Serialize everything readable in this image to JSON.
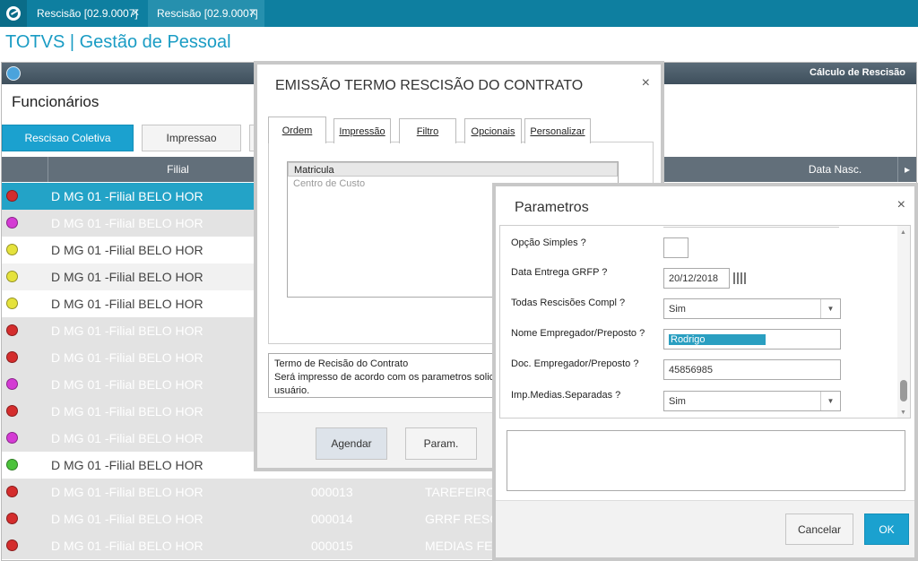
{
  "tabs": [
    {
      "label": "Rescisão [02.9.0007]"
    },
    {
      "label": "Rescisão [02.9.0007]"
    }
  ],
  "app_title": "TOTVS | Gestão de Pessoal",
  "main": {
    "bar_title": "Cálculo de Rescisão",
    "section_title": "Funcionários",
    "buttons": {
      "rescisao": "Rescisao Coletiva",
      "impressao": "Impressao"
    },
    "columns": {
      "filial": "Filial",
      "data_nasc": "Data Nasc."
    },
    "rows": [
      {
        "filial": "D MG 01 -Filial BELO HOR",
        "mat": "",
        "func": ""
      },
      {
        "filial": "D MG 01 -Filial BELO HOR",
        "mat": "",
        "func": ""
      },
      {
        "filial": "D MG 01 -Filial BELO HOR",
        "mat": "",
        "func": ""
      },
      {
        "filial": "D MG 01 -Filial BELO HOR",
        "mat": "",
        "func": ""
      },
      {
        "filial": "D MG 01 -Filial BELO HOR",
        "mat": "",
        "func": ""
      },
      {
        "filial": "D MG 01 -Filial BELO HOR",
        "mat": "",
        "func": ""
      },
      {
        "filial": "D MG 01 -Filial BELO HOR",
        "mat": "",
        "func": ""
      },
      {
        "filial": "D MG 01 -Filial BELO HOR",
        "mat": "",
        "func": ""
      },
      {
        "filial": "D MG 01 -Filial BELO HOR",
        "mat": "",
        "func": ""
      },
      {
        "filial": "D MG 01 -Filial BELO HOR",
        "mat": "",
        "func": ""
      },
      {
        "filial": "D MG 01 -Filial BELO HOR",
        "mat": "",
        "func": ""
      },
      {
        "filial": "D MG 01 -Filial BELO HOR",
        "mat": "000013",
        "func": "TAREFEIRO"
      },
      {
        "filial": "D MG 01 -Filial BELO HOR",
        "mat": "000014",
        "func": "GRRF RESC"
      },
      {
        "filial": "D MG 01 -Filial BELO HOR",
        "mat": "000015",
        "func": "MEDIAS FE"
      }
    ],
    "status_colors": [
      "#d42d2d",
      "#d43bd4",
      "#e5e23c",
      "#e5e23c",
      "#e5e23c",
      "#d42d2d",
      "#d42d2d",
      "#d43bd4",
      "#d42d2d",
      "#d43bd4",
      "#4cc23b",
      "#d42d2d",
      "#d42d2d",
      "#d42d2d"
    ]
  },
  "dialog_emissao": {
    "title": "EMISSÃO TERMO RESCISÃO DO CONTRATO",
    "close": "×",
    "tabs": [
      "Ordem",
      "Impressão",
      "Filtro",
      "Opcionais",
      "Personalizar"
    ],
    "list": [
      "Matricula",
      "Centro de Custo"
    ],
    "description": "Termo de Recisão do Contrato\nSerá impresso de acordo com os parametros solici\nusuário.",
    "buttons": {
      "agendar": "Agendar",
      "param": "Param."
    }
  },
  "dialog_parametros": {
    "title": "Parametros",
    "close": "×",
    "fields": [
      {
        "label": "Opção Simples ?",
        "value": ""
      },
      {
        "label": "Data Entrega GRFP ?",
        "value": "20/12/2018"
      },
      {
        "label": "Todas Rescisões Compl ?",
        "value": "Sim"
      },
      {
        "label": "Nome Empregador/Preposto ?",
        "value": "Rodrigo"
      },
      {
        "label": "Doc. Empregador/Preposto ?",
        "value": "45856985"
      },
      {
        "label": "Imp.Medias.Separadas ?",
        "value": "Sim"
      }
    ],
    "buttons": {
      "cancel": "Cancelar",
      "ok": "OK"
    }
  }
}
